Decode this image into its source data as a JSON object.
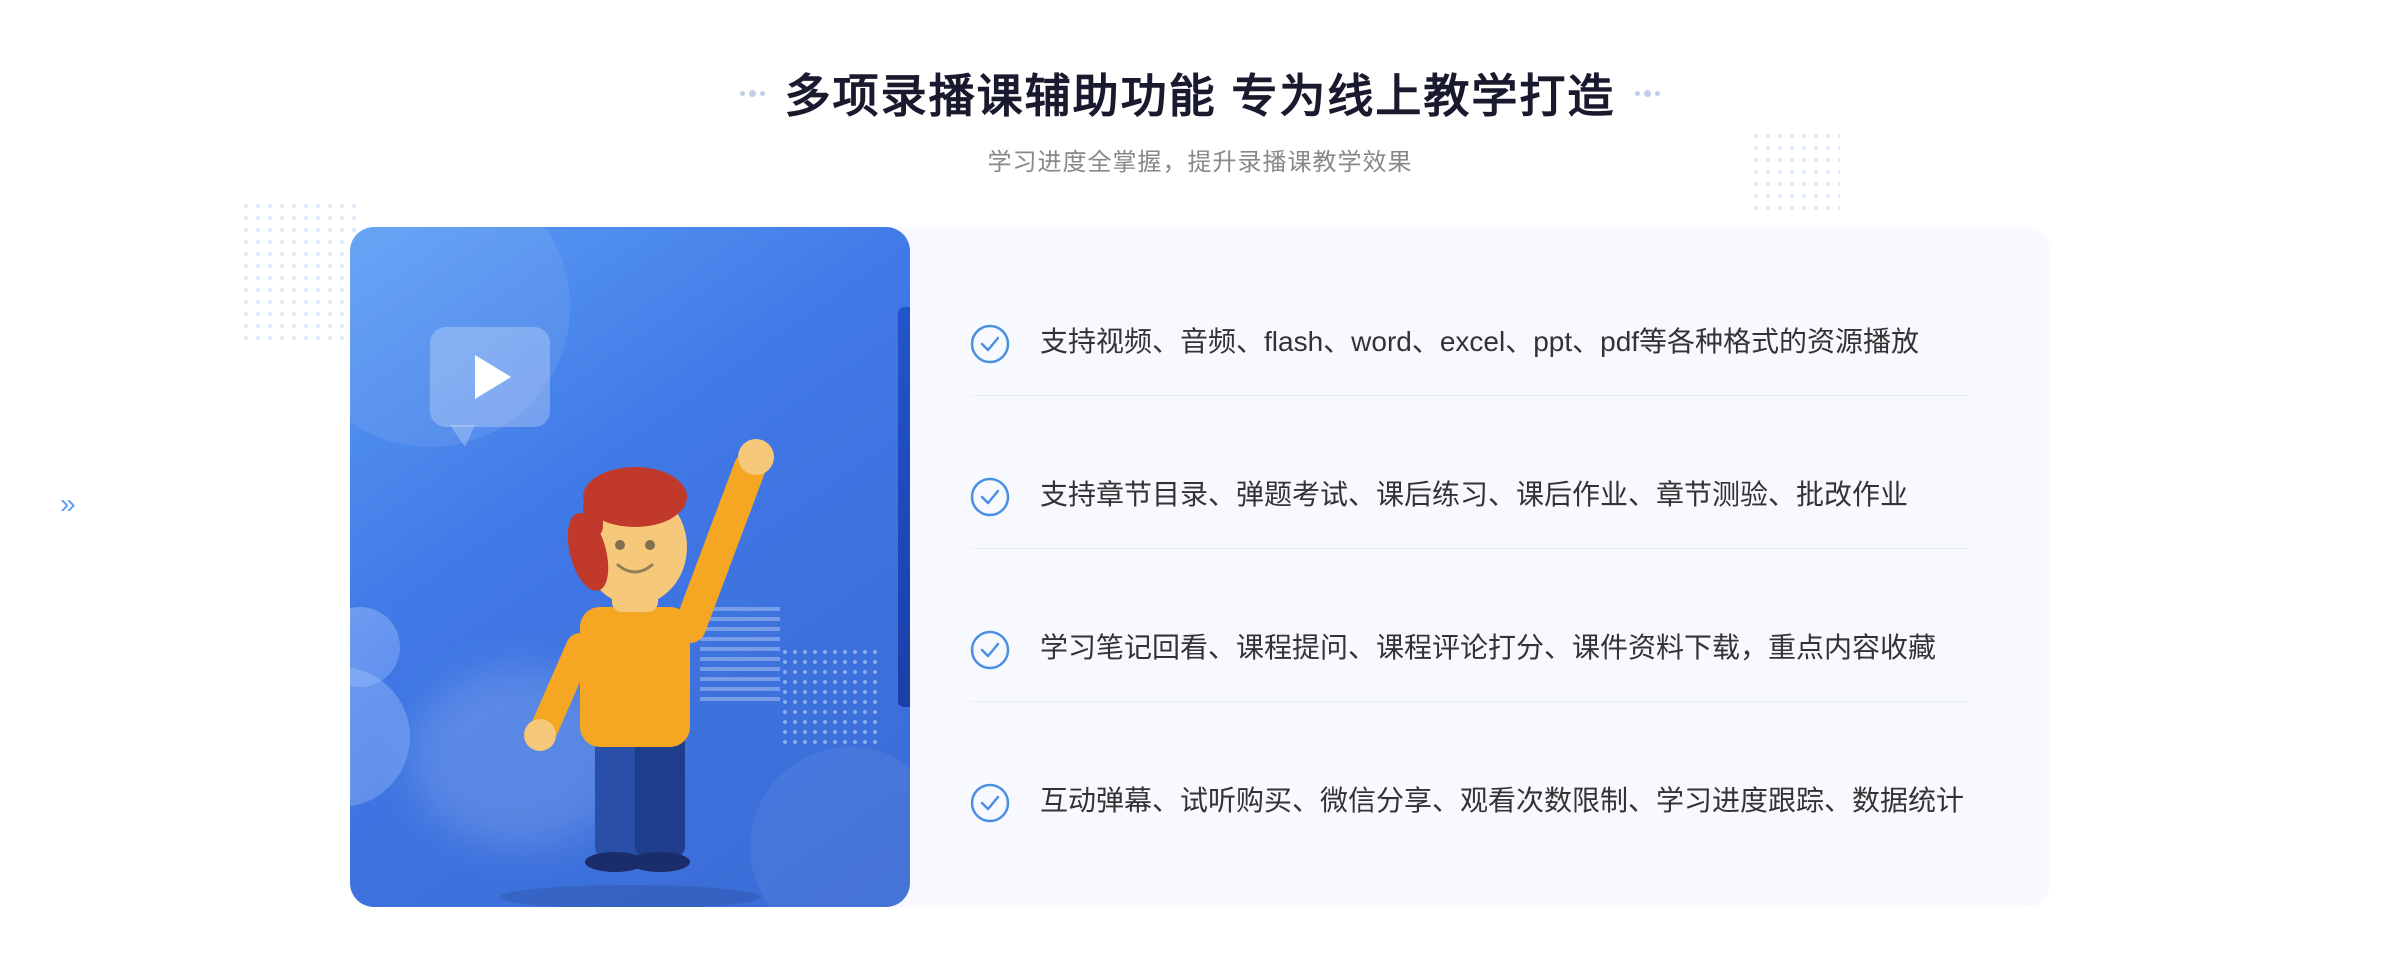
{
  "page": {
    "title": "多项录播课辅助功能 专为线上教学打造",
    "subtitle": "学习进度全掌握，提升录播课教学效果",
    "decoratorLabel": "dots"
  },
  "features": [
    {
      "id": "feature-1",
      "text": "支持视频、音频、flash、word、excel、ppt、pdf等各种格式的资源播放"
    },
    {
      "id": "feature-2",
      "text": "支持章节目录、弹题考试、课后练习、课后作业、章节测验、批改作业"
    },
    {
      "id": "feature-3",
      "text": "学习笔记回看、课程提问、课程评论打分、课件资料下载，重点内容收藏"
    },
    {
      "id": "feature-4",
      "text": "互动弹幕、试听购买、微信分享、观看次数限制、学习进度跟踪、数据统计"
    }
  ],
  "colors": {
    "primary": "#4078e6",
    "check": "#4a90e2",
    "title": "#1a1a2e",
    "subtitle": "#888888",
    "featureText": "#333333",
    "cardBg": "#f8f9ff"
  },
  "icons": {
    "check": "circle-check",
    "play": "play-triangle",
    "chevronRight": "»"
  }
}
